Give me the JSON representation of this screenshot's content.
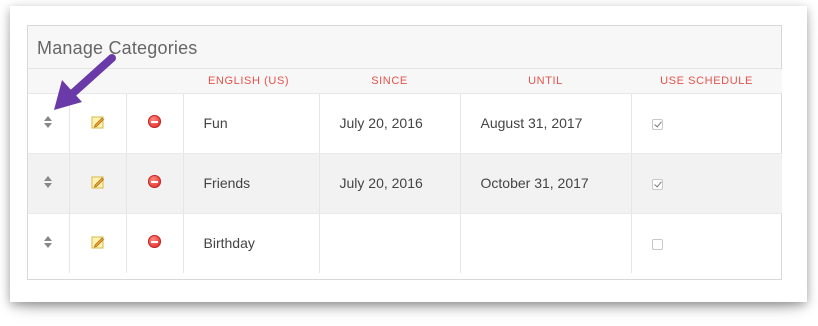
{
  "panel": {
    "title": "Manage Categories"
  },
  "columns": [
    "",
    "",
    "",
    "ENGLISH (US)",
    "SINCE",
    "UNTIL",
    "USE SCHEDULE"
  ],
  "rows": [
    {
      "name": "Fun",
      "since": "July 20, 2016",
      "until": "August 31, 2017",
      "use_schedule": true
    },
    {
      "name": "Friends",
      "since": "July 20, 2016",
      "until": "October 31, 2017",
      "use_schedule": true
    },
    {
      "name": "Birthday",
      "since": "",
      "until": "",
      "use_schedule": false
    }
  ],
  "icons": {
    "sort": "sort-handle-icon",
    "edit": "pencil-icon",
    "delete": "minus-circle-icon"
  },
  "colors": {
    "header_text": "#e5534b",
    "annotation_arrow": "#6a3aa8",
    "delete": "#e53935"
  }
}
